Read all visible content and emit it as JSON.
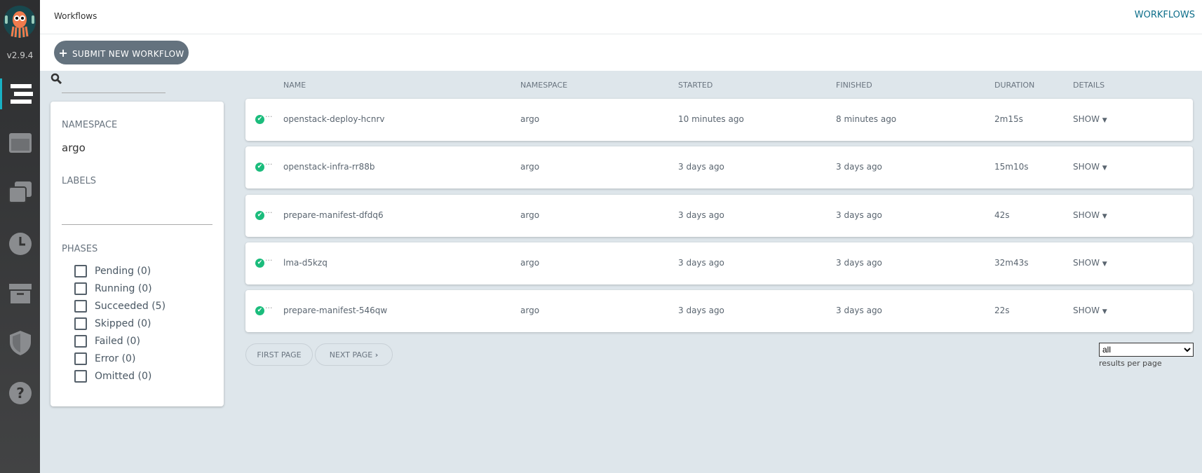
{
  "app": {
    "version": "v2.9.4",
    "title": "Workflows",
    "top_link": "WORKFLOWS",
    "accent": "#18b1c4"
  },
  "sidebar": {
    "items": [
      {
        "icon": "workflows-icon"
      },
      {
        "icon": "workflow-templates-icon"
      },
      {
        "icon": "cluster-templates-icon"
      },
      {
        "icon": "cron-icon"
      },
      {
        "icon": "archive-icon"
      },
      {
        "icon": "shield-icon"
      },
      {
        "icon": "help-icon"
      }
    ]
  },
  "toolbar": {
    "submit_label": "SUBMIT NEW WORKFLOW"
  },
  "filters": {
    "namespace_label": "NAMESPACE",
    "namespace_value": "argo",
    "labels_label": "LABELS",
    "phases_label": "PHASES",
    "phases": [
      "Pending (0)",
      "Running (0)",
      "Succeeded (5)",
      "Skipped (0)",
      "Failed (0)",
      "Error (0)",
      "Omitted (0)"
    ]
  },
  "table": {
    "headers": [
      "NAME",
      "NAMESPACE",
      "STARTED",
      "FINISHED",
      "DURATION",
      "DETAILS"
    ],
    "rows": [
      {
        "name": "openstack-deploy-hcnrv",
        "namespace": "argo",
        "started": "10 minutes ago",
        "finished": "8 minutes ago",
        "duration": "2m15s",
        "details": "SHOW",
        "status": "succeeded"
      },
      {
        "name": "openstack-infra-rr88b",
        "namespace": "argo",
        "started": "3 days ago",
        "finished": "3 days ago",
        "duration": "15m10s",
        "details": "SHOW",
        "status": "succeeded"
      },
      {
        "name": "prepare-manifest-dfdq6",
        "namespace": "argo",
        "started": "3 days ago",
        "finished": "3 days ago",
        "duration": "42s",
        "details": "SHOW",
        "status": "succeeded"
      },
      {
        "name": "lma-d5kzq",
        "namespace": "argo",
        "started": "3 days ago",
        "finished": "3 days ago",
        "duration": "32m43s",
        "details": "SHOW",
        "status": "succeeded"
      },
      {
        "name": "prepare-manifest-546qw",
        "namespace": "argo",
        "started": "3 days ago",
        "finished": "3 days ago",
        "duration": "22s",
        "details": "SHOW",
        "status": "succeeded"
      }
    ]
  },
  "pagination": {
    "first": "FIRST PAGE",
    "next": "NEXT PAGE",
    "per_page_value": "all",
    "per_page_label": "results per page"
  }
}
